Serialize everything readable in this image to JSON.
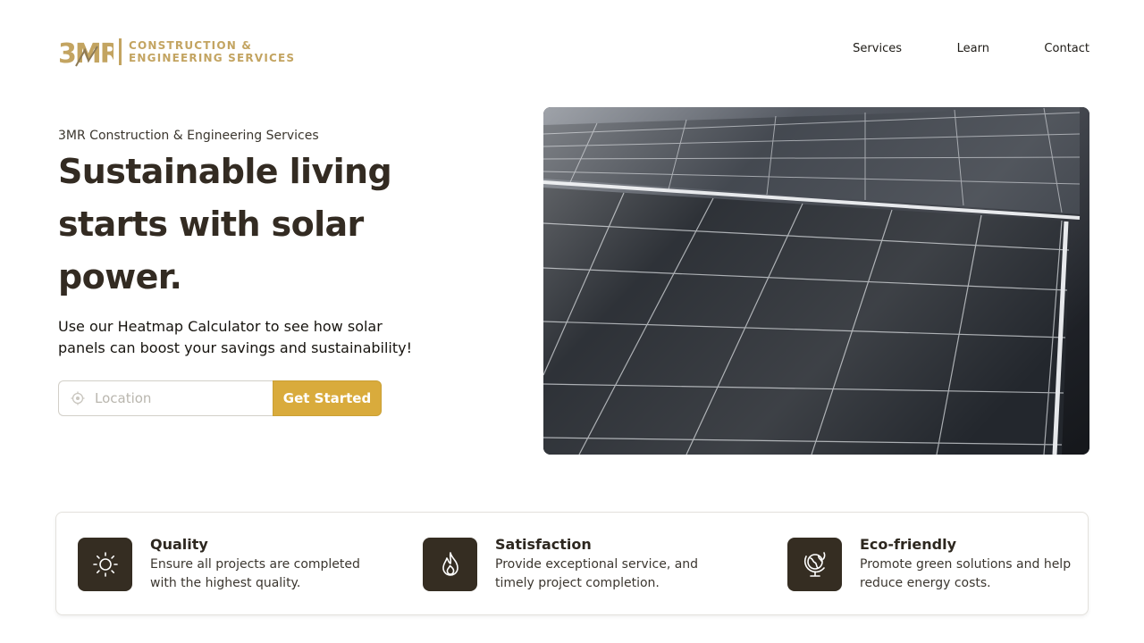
{
  "header": {
    "logo": {
      "mark_text": "3MR",
      "line1": "CONSTRUCTION &",
      "line2": "ENGINEERING SERVICES"
    },
    "nav": [
      {
        "label": "Services"
      },
      {
        "label": "Learn"
      },
      {
        "label": "Contact"
      }
    ]
  },
  "hero": {
    "eyebrow": "3MR Construction & Engineering Services",
    "title": "Sustainable living starts with solar power.",
    "subtitle": "Use our Heatmap Calculator to see how solar panels can boost your savings and sustainability!",
    "search": {
      "placeholder": "Location",
      "value": "",
      "icon": "location-pin-icon"
    },
    "cta_label": "Get Started",
    "image": {
      "subject": "solar-panels-photo"
    }
  },
  "features": [
    {
      "icon": "sun-icon",
      "title": "Quality",
      "description": "Ensure all projects are completed with the highest quality."
    },
    {
      "icon": "flame-icon",
      "title": "Satisfaction",
      "description": "Provide exceptional service, and timely project completion."
    },
    {
      "icon": "eco-globe-icon",
      "title": "Eco-friendly",
      "description": "Promote green solutions and help reduce energy costs."
    }
  ],
  "colors": {
    "brand_gold": "#c3a461",
    "cta": "#d9ab3c",
    "icon_bg": "#352d22",
    "heading": "#332b22"
  }
}
